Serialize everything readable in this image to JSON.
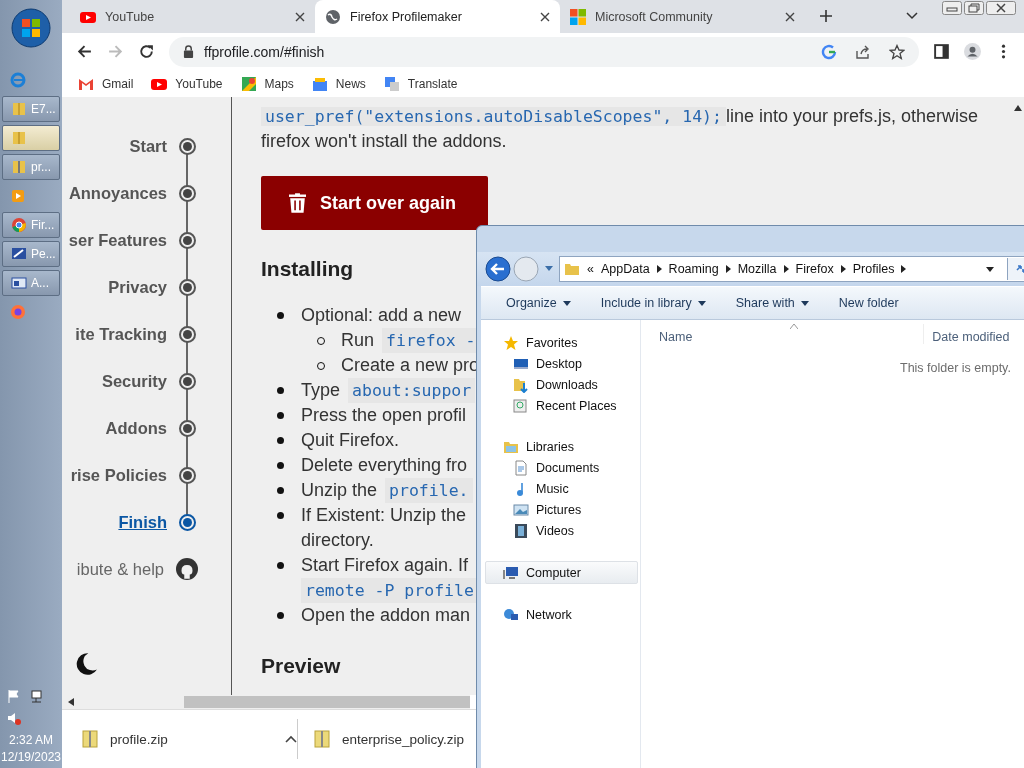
{
  "taskbar": {
    "items": [
      {
        "kind": "ie",
        "selected": false
      },
      {
        "kind": "folder",
        "label": "E7...",
        "selected": false
      },
      {
        "kind": "folder",
        "selected": true
      },
      {
        "kind": "zip",
        "label": "pr...",
        "selected": false
      },
      {
        "kind": "media",
        "selected": false
      },
      {
        "kind": "chrome",
        "label": "Fir...",
        "selected": false
      },
      {
        "kind": "paint",
        "label": "Pe...",
        "selected": false
      },
      {
        "kind": "app",
        "label": "A...",
        "selected": false
      },
      {
        "kind": "firefox",
        "selected": false
      }
    ],
    "time": "2:32 AM",
    "date": "12/19/2023"
  },
  "browser": {
    "tabs": [
      {
        "kind": "youtube",
        "title": "YouTube",
        "selected": false
      },
      {
        "kind": "globe",
        "title": "Firefox Profilemaker",
        "selected": true
      },
      {
        "kind": "microsoft",
        "title": "Microsoft Community",
        "selected": false
      }
    ],
    "url": "ffprofile.com/#finish",
    "forward_disabled": true,
    "bookmarks": [
      {
        "kind": "gmail",
        "label": "Gmail"
      },
      {
        "kind": "youtube",
        "label": "YouTube"
      },
      {
        "kind": "maps",
        "label": "Maps"
      },
      {
        "kind": "news",
        "label": "News"
      },
      {
        "kind": "translate",
        "label": "Translate"
      }
    ]
  },
  "page": {
    "nav": [
      {
        "label": "Start",
        "selected": false
      },
      {
        "label": "Annoyances",
        "selected": false
      },
      {
        "label": "ser Features",
        "selected": false
      },
      {
        "label": "Privacy",
        "selected": false
      },
      {
        "label": "ite Tracking",
        "selected": false
      },
      {
        "label": "Security",
        "selected": false
      },
      {
        "label": "Addons",
        "selected": false
      },
      {
        "label": "rise Policies",
        "selected": false
      },
      {
        "label": "Finish",
        "selected": true
      }
    ],
    "contribute": "ibute & help",
    "intro": {
      "code": "user_pref(\"extensions.autoDisableScopes\", 14);",
      "text1": "line into your prefs.js, otherwise",
      "text2": "firefox won't install the addons."
    },
    "start_over_button": "Start over again",
    "installing_heading": "Installing",
    "steps": [
      {
        "lines": [
          {
            "text": "Optional: add a new"
          }
        ],
        "children": [
          {
            "lines": [
              {
                "text": "Run",
                "code": "firefox -"
              }
            ]
          },
          {
            "lines": [
              {
                "text": "Create a new pro"
              }
            ]
          }
        ]
      },
      {
        "lines": [
          {
            "text": "Type",
            "code": "about:suppor"
          }
        ]
      },
      {
        "lines": [
          {
            "text": "Press the open profil"
          }
        ]
      },
      {
        "lines": [
          {
            "text": "Quit Firefox."
          }
        ]
      },
      {
        "lines": [
          {
            "text": "Delete everything fro"
          }
        ]
      },
      {
        "lines": [
          {
            "text": "Unzip the",
            "code": "profile."
          }
        ]
      },
      {
        "lines": [
          {
            "text": "If Existent: Unzip the"
          },
          {
            "text": "directory."
          }
        ]
      },
      {
        "lines": [
          {
            "text": "Start Firefox again. If"
          },
          {
            "code": "remote -P profile"
          }
        ]
      },
      {
        "lines": [
          {
            "text": "Open the addon man"
          }
        ]
      }
    ],
    "preview_heading": "Preview"
  },
  "downloads": [
    {
      "name": "profile.zip"
    },
    {
      "name": "enterprise_policy.zip"
    }
  ],
  "explorer": {
    "breadcrumb": [
      "AppData",
      "Roaming",
      "Mozilla",
      "Firefox",
      "Profiles"
    ],
    "overflow": "«",
    "toolbar": [
      {
        "label": "Organize",
        "dropdown": true
      },
      {
        "label": "Include in library",
        "dropdown": true
      },
      {
        "label": "Share with",
        "dropdown": true
      },
      {
        "label": "New folder",
        "dropdown": false
      }
    ],
    "nav": [
      {
        "kind": "favorites",
        "label": "Favorites",
        "selected": false,
        "children": [
          {
            "kind": "desktop",
            "label": "Desktop",
            "selected": false
          },
          {
            "kind": "downloads",
            "label": "Downloads",
            "selected": false
          },
          {
            "kind": "recent",
            "label": "Recent Places",
            "selected": false
          }
        ]
      },
      {
        "kind": "libraries",
        "label": "Libraries",
        "selected": false,
        "children": [
          {
            "kind": "documents",
            "label": "Documents",
            "selected": false
          },
          {
            "kind": "music",
            "label": "Music",
            "selected": false
          },
          {
            "kind": "pictures",
            "label": "Pictures",
            "selected": false
          },
          {
            "kind": "videos",
            "label": "Videos",
            "selected": false
          }
        ]
      },
      {
        "kind": "computer",
        "label": "Computer",
        "selected": true
      },
      {
        "kind": "network",
        "label": "Network",
        "selected": false
      }
    ],
    "columns": [
      "Name",
      "Date modified"
    ],
    "empty_message": "This folder is empty."
  }
}
